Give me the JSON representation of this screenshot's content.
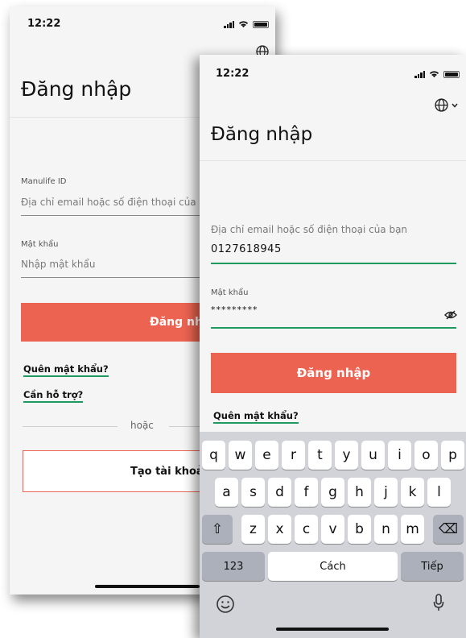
{
  "status_bar": {
    "time": "12:22"
  },
  "back_screen": {
    "title": "Đăng nhập",
    "id_label": "Manulife ID",
    "id_placeholder": "Địa chỉ email hoặc số điện thoại của bạn",
    "password_label": "Mật khẩu",
    "password_placeholder": "Nhập mật khẩu",
    "login_button": "Đăng nhập",
    "forgot_password": "Quên mật khẩu?",
    "need_help": "Cần hỗ trợ?",
    "or_text": "hoặc",
    "create_account": "Tạo tài khoản mới"
  },
  "front_screen": {
    "title": "Đăng nhập",
    "id_label": "Địa chỉ email hoặc số điện thoại của bạn",
    "id_value": "0127618945",
    "password_label": "Mật khẩu",
    "password_value": "*********",
    "login_button": "Đăng nhập",
    "forgot_password": "Quên mật khẩu?"
  },
  "keyboard": {
    "row1": [
      "q",
      "w",
      "e",
      "r",
      "t",
      "y",
      "u",
      "i",
      "o",
      "p"
    ],
    "row2": [
      "a",
      "s",
      "d",
      "f",
      "g",
      "h",
      "j",
      "k",
      "l"
    ],
    "row3": [
      "z",
      "x",
      "c",
      "v",
      "b",
      "n",
      "m"
    ],
    "numbers_key": "123",
    "space_key": "Cách",
    "return_key": "Tiếp",
    "shift_icon": "⇧",
    "delete_icon": "⌫",
    "emoji_icon": "☺",
    "mic_icon": "mic"
  },
  "colors": {
    "accent": "#ec6451",
    "underline_green": "#1e9a5f"
  }
}
